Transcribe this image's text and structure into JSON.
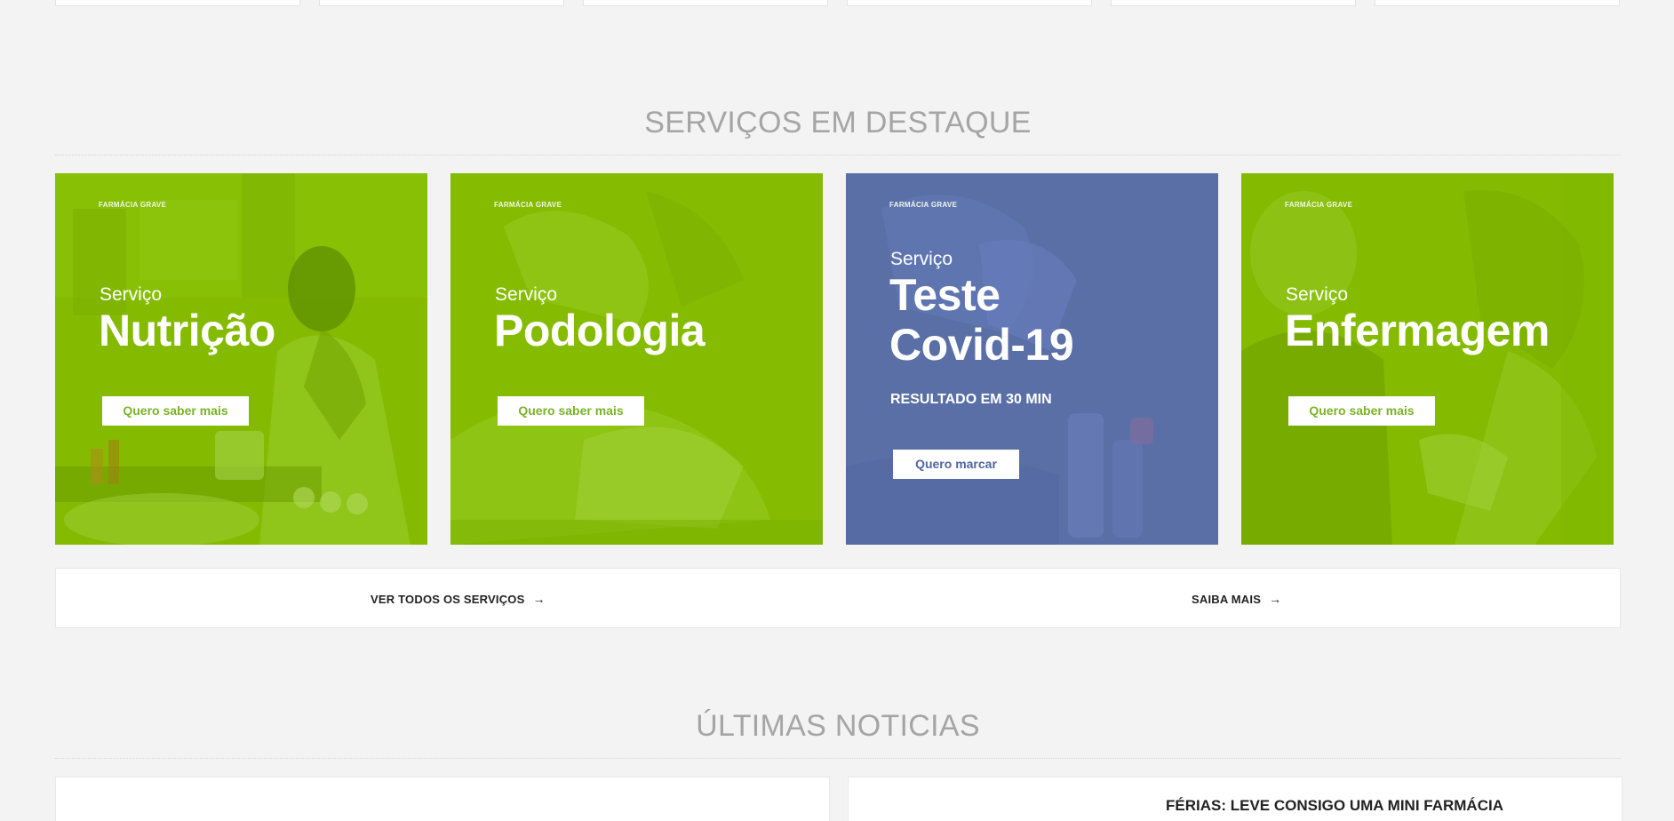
{
  "featured_services": {
    "title": "SERVIÇOS EM DESTAQUE",
    "cards": [
      {
        "brand": "FARMÁCIA GRAVE",
        "label": "Serviço",
        "name": "Nutrição",
        "button": "Quero saber mais"
      },
      {
        "brand": "FARMÁCIA GRAVE",
        "label": "Serviço",
        "name": "Podologia",
        "button": "Quero saber mais"
      },
      {
        "brand": "FARMÁCIA GRAVE",
        "label": "Serviço",
        "name_line1": "Teste",
        "name_line2": "Covid-19",
        "subtitle": "RESULTADO EM 30 MIN",
        "button": "Quero marcar"
      },
      {
        "brand": "FARMÁCIA GRAVE",
        "label": "Serviço",
        "name": "Enfermagem",
        "button": "Quero saber mais"
      }
    ],
    "links": {
      "all_services": "VER TODOS OS SERVIÇOS",
      "learn_more": "SAIBA MAIS",
      "arrow": "→"
    }
  },
  "latest_news": {
    "title": "ÚLTIMAS NOTICIAS",
    "items": [
      {
        "title": ""
      },
      {
        "title": "FÉRIAS: LEVE CONSIGO UMA MINI FARMÁCIA"
      }
    ]
  },
  "colors": {
    "green": "#84bb00",
    "blue": "#5a6fa6",
    "background": "#f3f3f3",
    "title_gray": "#a5a5a5"
  }
}
